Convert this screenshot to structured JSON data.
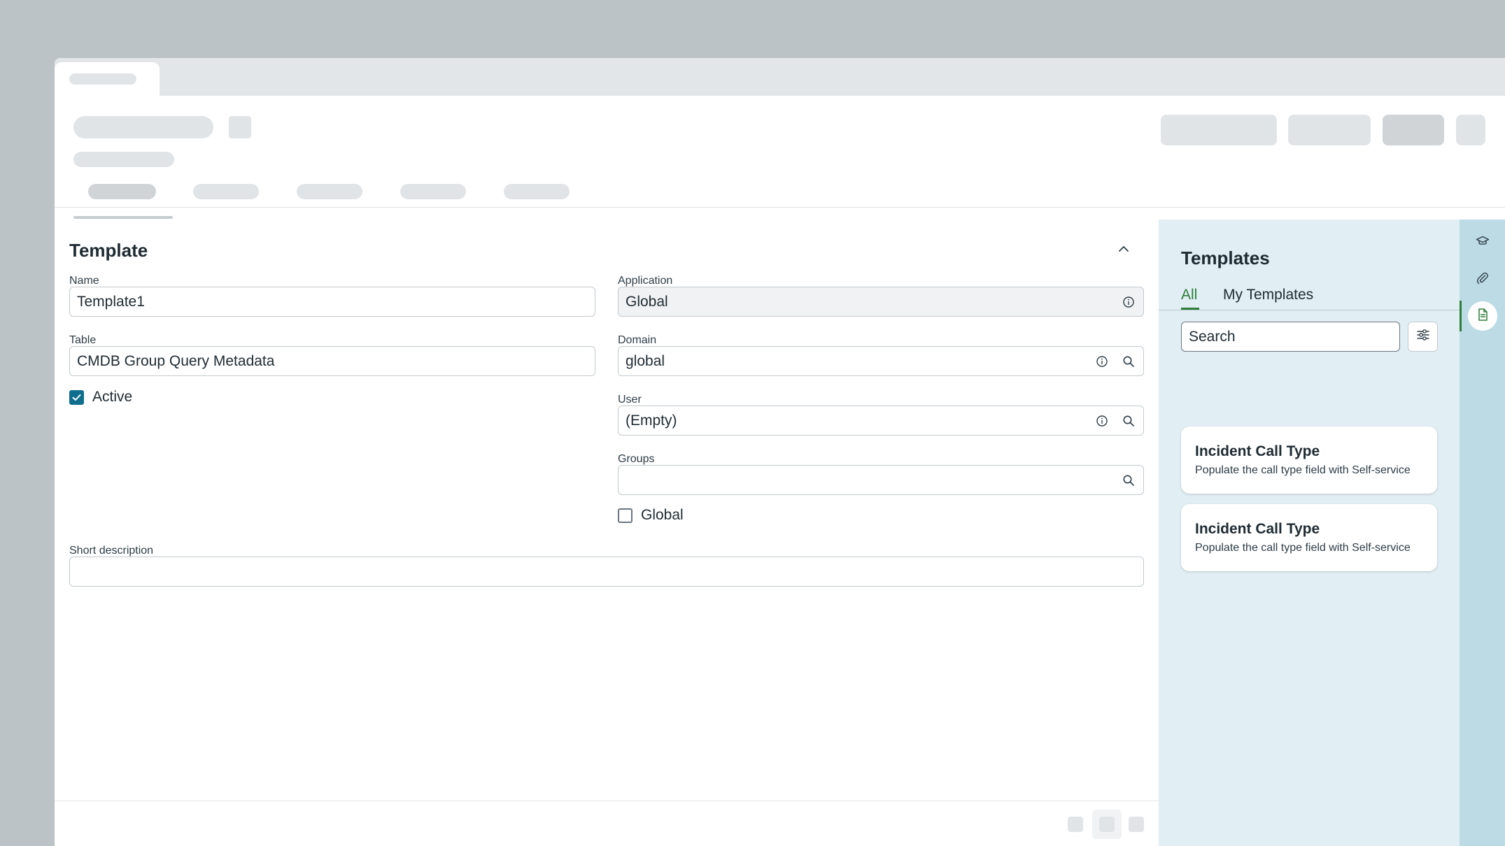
{
  "form": {
    "section_title": "Template",
    "name": {
      "label": "Name",
      "value": "Template1"
    },
    "table": {
      "label": "Table",
      "value": "CMDB Group Query Metadata"
    },
    "active": {
      "label": "Active",
      "checked": true
    },
    "application": {
      "label": "Application",
      "value": "Global"
    },
    "domain": {
      "label": "Domain",
      "value": "global"
    },
    "user": {
      "label": "User",
      "value": "(Empty)"
    },
    "groups": {
      "label": "Groups",
      "value": ""
    },
    "global": {
      "label": "Global",
      "checked": false
    },
    "short_description": {
      "label": "Short description",
      "value": ""
    }
  },
  "panel": {
    "title": "Templates",
    "tabs": [
      {
        "label": "All",
        "active": true
      },
      {
        "label": "My Templates",
        "active": false
      }
    ],
    "search": {
      "value": "Search"
    },
    "cards": [
      {
        "title": "Incident Call Type",
        "description": "Populate the call type field with Self-service"
      },
      {
        "title": "Incident Call Type",
        "description": "Populate the call type field with Self-service"
      }
    ]
  },
  "icons": {
    "collapse": "chevron-up-icon",
    "info": "info-icon",
    "search": "search-icon",
    "filter": "sliders-icon",
    "rail": [
      "graduation-cap-icon",
      "paperclip-icon",
      "document-icon"
    ]
  },
  "colors": {
    "accent_green": "#2e7d3a",
    "checkbox_blue": "#0f6d8e",
    "panel_bg": "#e1eff4",
    "rail_bg": "#bcdbe5"
  }
}
